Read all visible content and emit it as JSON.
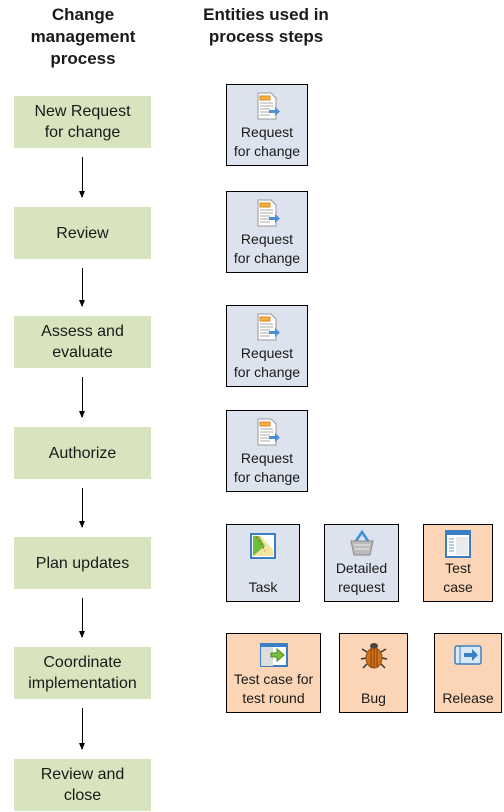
{
  "headers": {
    "process": [
      "Change management",
      "process"
    ],
    "entities": [
      "Entities used in",
      "process steps"
    ]
  },
  "colors": {
    "step_fill": "#d7e4bd",
    "entity_blue": "#dce3ee",
    "entity_peach": "#fbd5b5"
  },
  "steps": [
    {
      "lines": [
        "New Request",
        "for change"
      ]
    },
    {
      "lines": [
        "Review"
      ]
    },
    {
      "lines": [
        "Assess and",
        "evaluate"
      ]
    },
    {
      "lines": [
        "Authorize"
      ]
    },
    {
      "lines": [
        "Plan updates"
      ]
    },
    {
      "lines": [
        "Coordinate",
        "implementation"
      ]
    },
    {
      "lines": [
        "Review and",
        "close"
      ]
    }
  ],
  "entities": [
    {
      "step": 0,
      "icon": "request-for-change-icon",
      "lines": [
        "Request",
        "for change"
      ],
      "color": "blue"
    },
    {
      "step": 1,
      "icon": "request-for-change-icon",
      "lines": [
        "Request",
        "for change"
      ],
      "color": "blue"
    },
    {
      "step": 2,
      "icon": "request-for-change-icon",
      "lines": [
        "Request",
        "for change"
      ],
      "color": "blue"
    },
    {
      "step": 3,
      "icon": "request-for-change-icon",
      "lines": [
        "Request",
        "for change"
      ],
      "color": "blue"
    },
    {
      "step": 4,
      "icon": "task-icon",
      "lines": [
        "Task"
      ],
      "color": "blue"
    },
    {
      "step": 4,
      "icon": "detailed-request-icon",
      "lines": [
        "Detailed",
        "request"
      ],
      "color": "blue"
    },
    {
      "step": 4,
      "icon": "test-case-icon",
      "lines": [
        "Test",
        "case"
      ],
      "color": "peach"
    },
    {
      "step": 5,
      "icon": "test-case-for-test-round-icon",
      "lines": [
        "Test case for",
        "test round"
      ],
      "color": "peach"
    },
    {
      "step": 5,
      "icon": "bug-icon",
      "lines": [
        "Bug"
      ],
      "color": "peach"
    },
    {
      "step": 5,
      "icon": "release-icon",
      "lines": [
        "Release"
      ],
      "color": "peach"
    }
  ]
}
